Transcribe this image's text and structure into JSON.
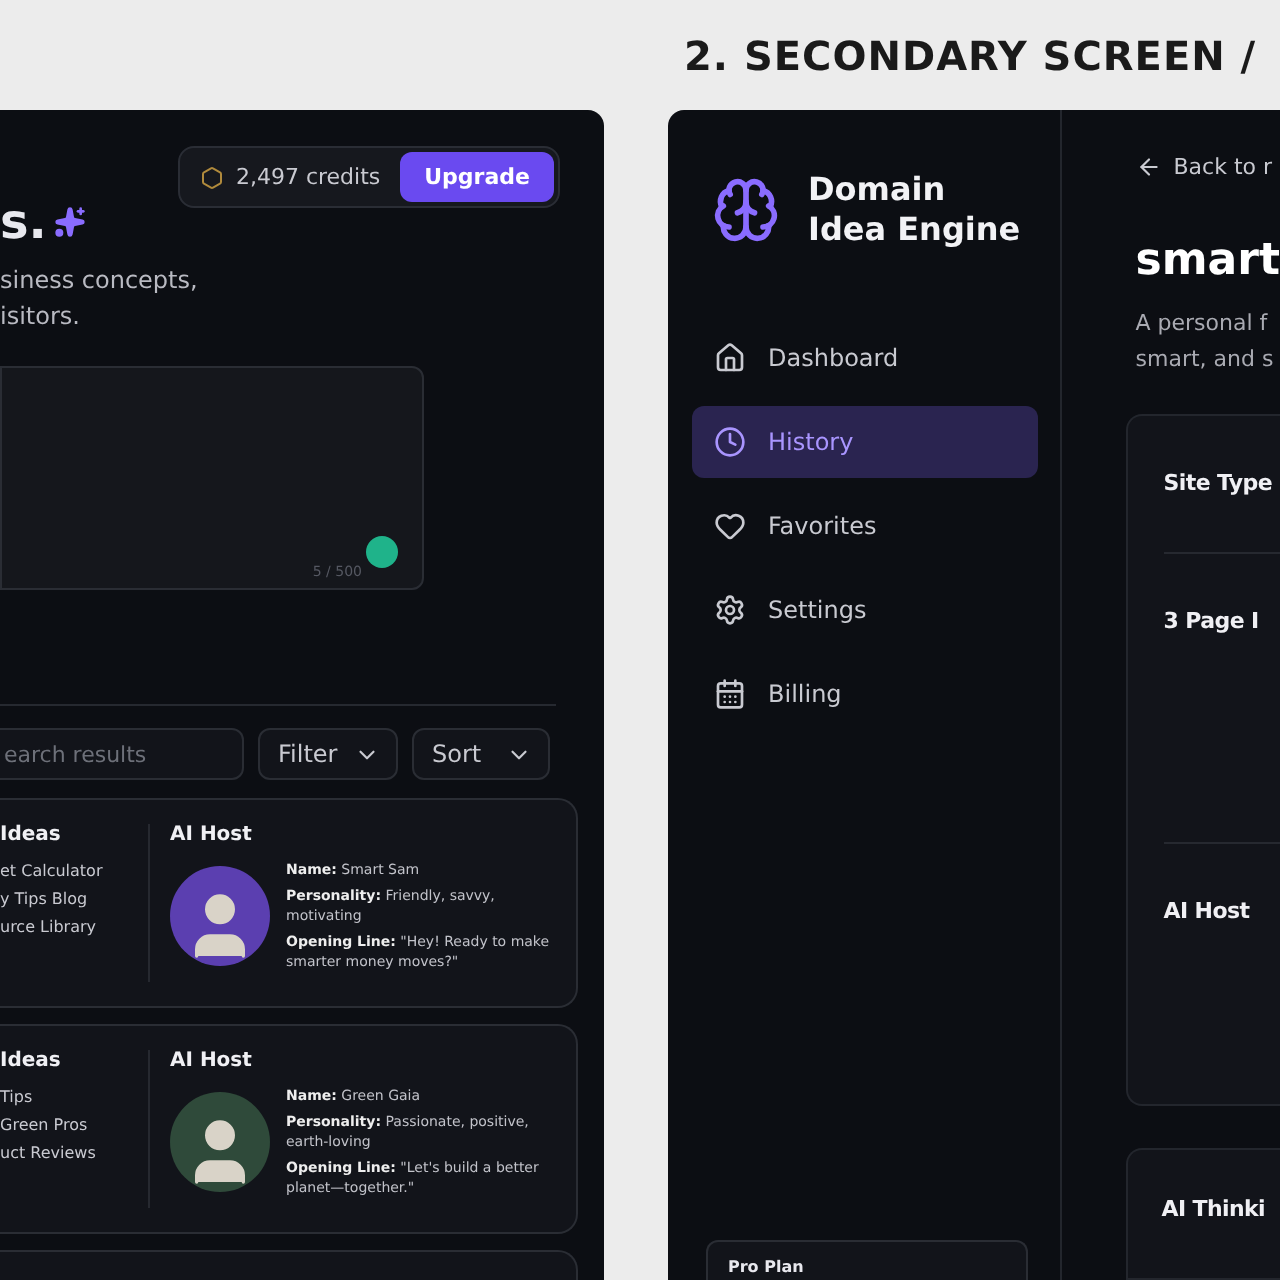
{
  "left_screen": {
    "title": "s.",
    "credits": {
      "amount": "2,497 credits",
      "button": "Upgrade"
    },
    "subtitle": "siness concepts,\nisitors.",
    "prompt": {
      "counter": "5 / 500"
    },
    "toolbar": {
      "search": {
        "placeholder": "earch results"
      },
      "filter": "Filter",
      "sort": "Sort"
    },
    "results": [
      {
        "ideas_heading": "Ideas",
        "ideas": [
          "et Calculator",
          "y Tips Blog",
          "urce Library"
        ],
        "host_heading": "AI Host",
        "host": {
          "color": "#5b3fb0",
          "name": "**Name:** Smart Sam",
          "personality": "**Personality:** Friendly, savvy, motivating",
          "opening_line": "**Opening Line:** \"Hey! Ready to make smarter money moves?\""
        }
      },
      {
        "ideas_heading": "Ideas",
        "ideas": [
          "Tips",
          "Green Pros",
          "uct Reviews"
        ],
        "host_heading": "AI Host",
        "host": {
          "color": "#2f4a3a",
          "name": "**Name:** Green Gaia",
          "personality": "**Personality:** Passionate, positive, earth-loving",
          "opening_line": "**Opening Line:** \"Let's build a better planet—together.\""
        }
      }
    ]
  },
  "right_screen": {
    "heading": "2. SECONDARY SCREEN /",
    "app_name": "Domain\nIdea Engine",
    "nav": [
      {
        "label": "Dashboard",
        "selected": false
      },
      {
        "label": "History",
        "selected": true
      },
      {
        "label": "Favorites",
        "selected": false
      },
      {
        "label": "Settings",
        "selected": false
      },
      {
        "label": "Billing",
        "selected": false
      }
    ],
    "plan": "Pro Plan",
    "back_link": "Back to r",
    "title": "smart",
    "description": "A personal f\nsmart, and s",
    "details": [
      "Site Type",
      "3 Page I",
      "AI Host"
    ],
    "thinking": "AI Thinki"
  }
}
